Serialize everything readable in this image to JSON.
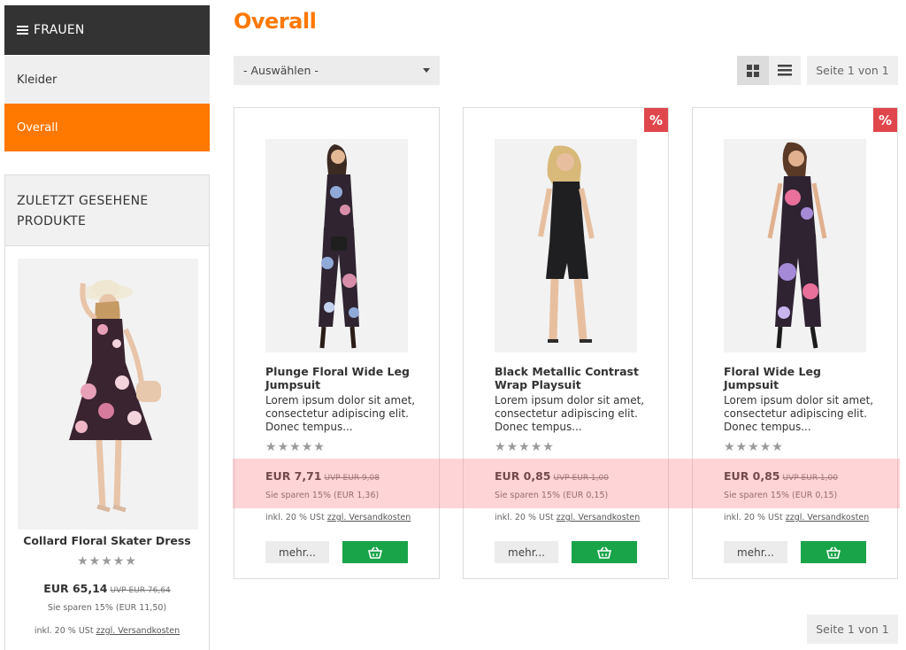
{
  "sidebar": {
    "category_header": "FRAUEN",
    "items": [
      {
        "label": "Kleider",
        "active": false
      },
      {
        "label": "Overall",
        "active": true
      }
    ],
    "recent": {
      "title": "ZULETZT GESEHENE PRODUKTE",
      "product": {
        "name": "Collard Floral Skater Dress",
        "rating": 0,
        "price": "EUR 65,14",
        "uvp": "UVP EUR 76,64",
        "savings": "Sie sparen 15% (EUR 11,50)",
        "tax_prefix": "inkl. 20 % USt",
        "shipping_link": "zzgl. Versandkosten"
      }
    }
  },
  "main": {
    "title": "Overall",
    "sort_select": {
      "value": "- Auswählen -"
    },
    "pagination": {
      "label": "Seite 1 von 1"
    },
    "products": [
      {
        "name": "Plunge Floral Wide Leg Jumpsuit",
        "description": "Lorem ipsum dolor sit amet, consectetur adipiscing elit. Donec tempus...",
        "rating": 0,
        "price": "EUR 7,71",
        "uvp": "UVP EUR 9,08",
        "savings": "Sie sparen 15% (EUR 1,36)",
        "tax_prefix": "inkl. 20 % USt",
        "shipping_link": "zzgl. Versandkosten",
        "more_label": "mehr...",
        "badge": ""
      },
      {
        "name": "Black Metallic Contrast Wrap Playsuit",
        "description": "Lorem ipsum dolor sit amet, consectetur adipiscing elit. Donec tempus...",
        "rating": 0,
        "price": "EUR 0,85",
        "uvp": "UVP EUR 1,00",
        "savings": "Sie sparen 15% (EUR 0,15)",
        "tax_prefix": "inkl. 20 % USt",
        "shipping_link": "zzgl. Versandkosten",
        "more_label": "mehr...",
        "badge": "%"
      },
      {
        "name": "Floral Wide Leg Jumpsuit",
        "description": "Lorem ipsum dolor sit amet, consectetur adipiscing elit. Donec tempus...",
        "rating": 0,
        "price": "EUR 0,85",
        "uvp": "UVP EUR 1,00",
        "savings": "Sie sparen 15% (EUR 0,15)",
        "tax_prefix": "inkl. 20 % USt",
        "shipping_link": "zzgl. Versandkosten",
        "more_label": "mehr...",
        "badge": "%"
      }
    ]
  },
  "icons": {
    "menu": "hamburger-icon",
    "grid_view": "grid-icon",
    "list_view": "list-icon",
    "cart": "basket-icon",
    "discount": "percent-icon",
    "star": "star-icon",
    "caret": "chevron-down-icon"
  },
  "colors": {
    "accent": "#ff7800",
    "header_dark": "#333333",
    "cart_green": "#1aa44a",
    "discount_badge": "#e0474c",
    "star_gray": "#9a9a9a",
    "highlight": "#ff7882"
  }
}
